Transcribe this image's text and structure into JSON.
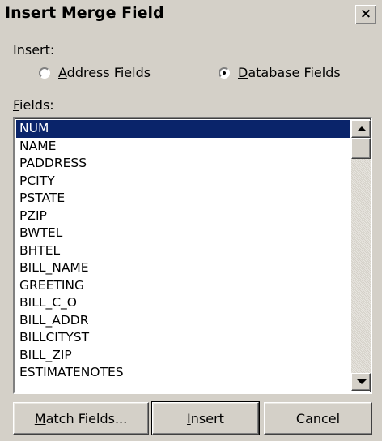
{
  "window": {
    "title": "Insert Merge Field",
    "close_glyph": "×"
  },
  "insert_group": {
    "label_accel": "",
    "label_rest": "Insert:",
    "options": [
      {
        "accel": "A",
        "rest": "ddress Fields",
        "selected": false
      },
      {
        "accel": "D",
        "rest": "atabase Fields",
        "selected": true
      }
    ]
  },
  "fields_label": {
    "accel": "F",
    "rest": "ields:"
  },
  "fields": [
    "NUM",
    "NAME",
    "PADDRESS",
    "PCITY",
    "PSTATE",
    "PZIP",
    "BWTEL",
    "BHTEL",
    "BILL_NAME",
    "GREETING",
    "BILL_C_O",
    "BILL_ADDR",
    "BILLCITYST",
    "BILL_ZIP",
    "ESTIMATENOTES"
  ],
  "selected_field": "NUM",
  "buttons": {
    "match": {
      "accel": "M",
      "rest": "atch Fields..."
    },
    "insert": {
      "accel": "I",
      "rest": "nsert"
    },
    "cancel": {
      "label": "Cancel"
    }
  },
  "colors": {
    "face": "#d4d0c8",
    "selection": "#0a246a",
    "selection_text": "#ffffff"
  },
  "icons": {
    "scroll_up": "triangle-up-icon",
    "scroll_down": "triangle-down-icon",
    "close": "close-icon"
  }
}
